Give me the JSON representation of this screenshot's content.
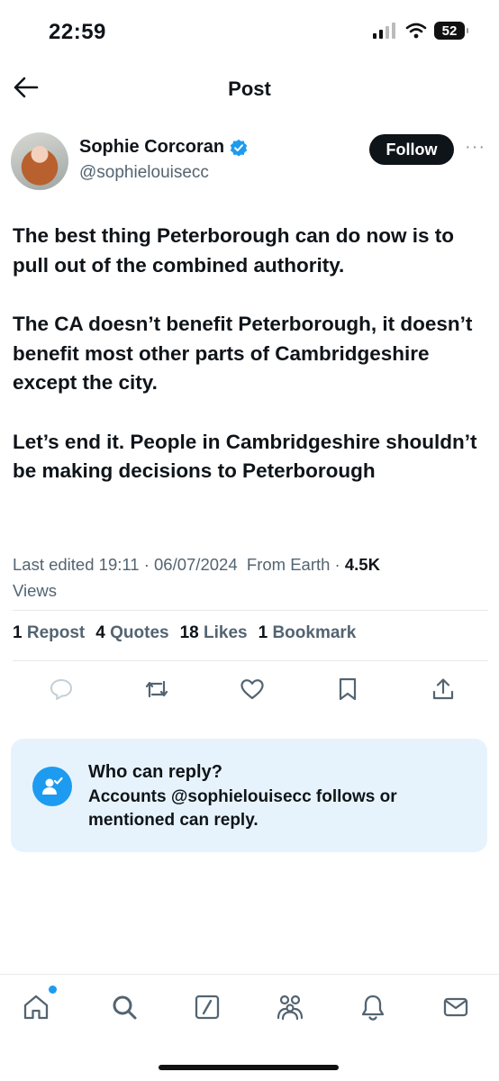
{
  "status_bar": {
    "time": "22:59",
    "battery": "52"
  },
  "header": {
    "title": "Post"
  },
  "author": {
    "name": "Sophie Corcoran",
    "handle": "@sophielouisecc",
    "follow_label": "Follow",
    "more_label": "···"
  },
  "post": {
    "paragraphs": [
      "The best thing Peterborough can do now is to pull out of the combined authority.",
      "The CA doesn’t benefit Peterborough, it doesn’t benefit most other parts of Cambridgeshire except the city.",
      "Let’s end it. People in Cambridgeshire shouldn’t be making decisions to Peterborough"
    ],
    "edited_label": "Last edited 19:11 · 06/07/2024",
    "location_label": "From Earth ·",
    "views_count": "4.5K",
    "views_label": "Views"
  },
  "stats": [
    {
      "count": "1",
      "label": "Repost"
    },
    {
      "count": "4",
      "label": "Quotes"
    },
    {
      "count": "18",
      "label": "Likes"
    },
    {
      "count": "1",
      "label": "Bookmark"
    }
  ],
  "reply_notice": {
    "title": "Who can reply?",
    "description": "Accounts @sophielouisecc follows or mentioned can reply."
  },
  "icons": {
    "back": "arrow-left-icon",
    "verified": "verified-badge-icon",
    "actions": [
      "reply-icon",
      "repost-icon",
      "like-icon",
      "bookmark-icon",
      "share-icon"
    ],
    "tabs": [
      "home-icon",
      "search-icon",
      "grok-icon",
      "communities-icon",
      "notifications-icon",
      "messages-icon"
    ]
  },
  "colors": {
    "accent": "#1d9bf0",
    "text": "#0f1419",
    "muted": "#536471",
    "reply_box_bg": "#e7f3fc"
  }
}
